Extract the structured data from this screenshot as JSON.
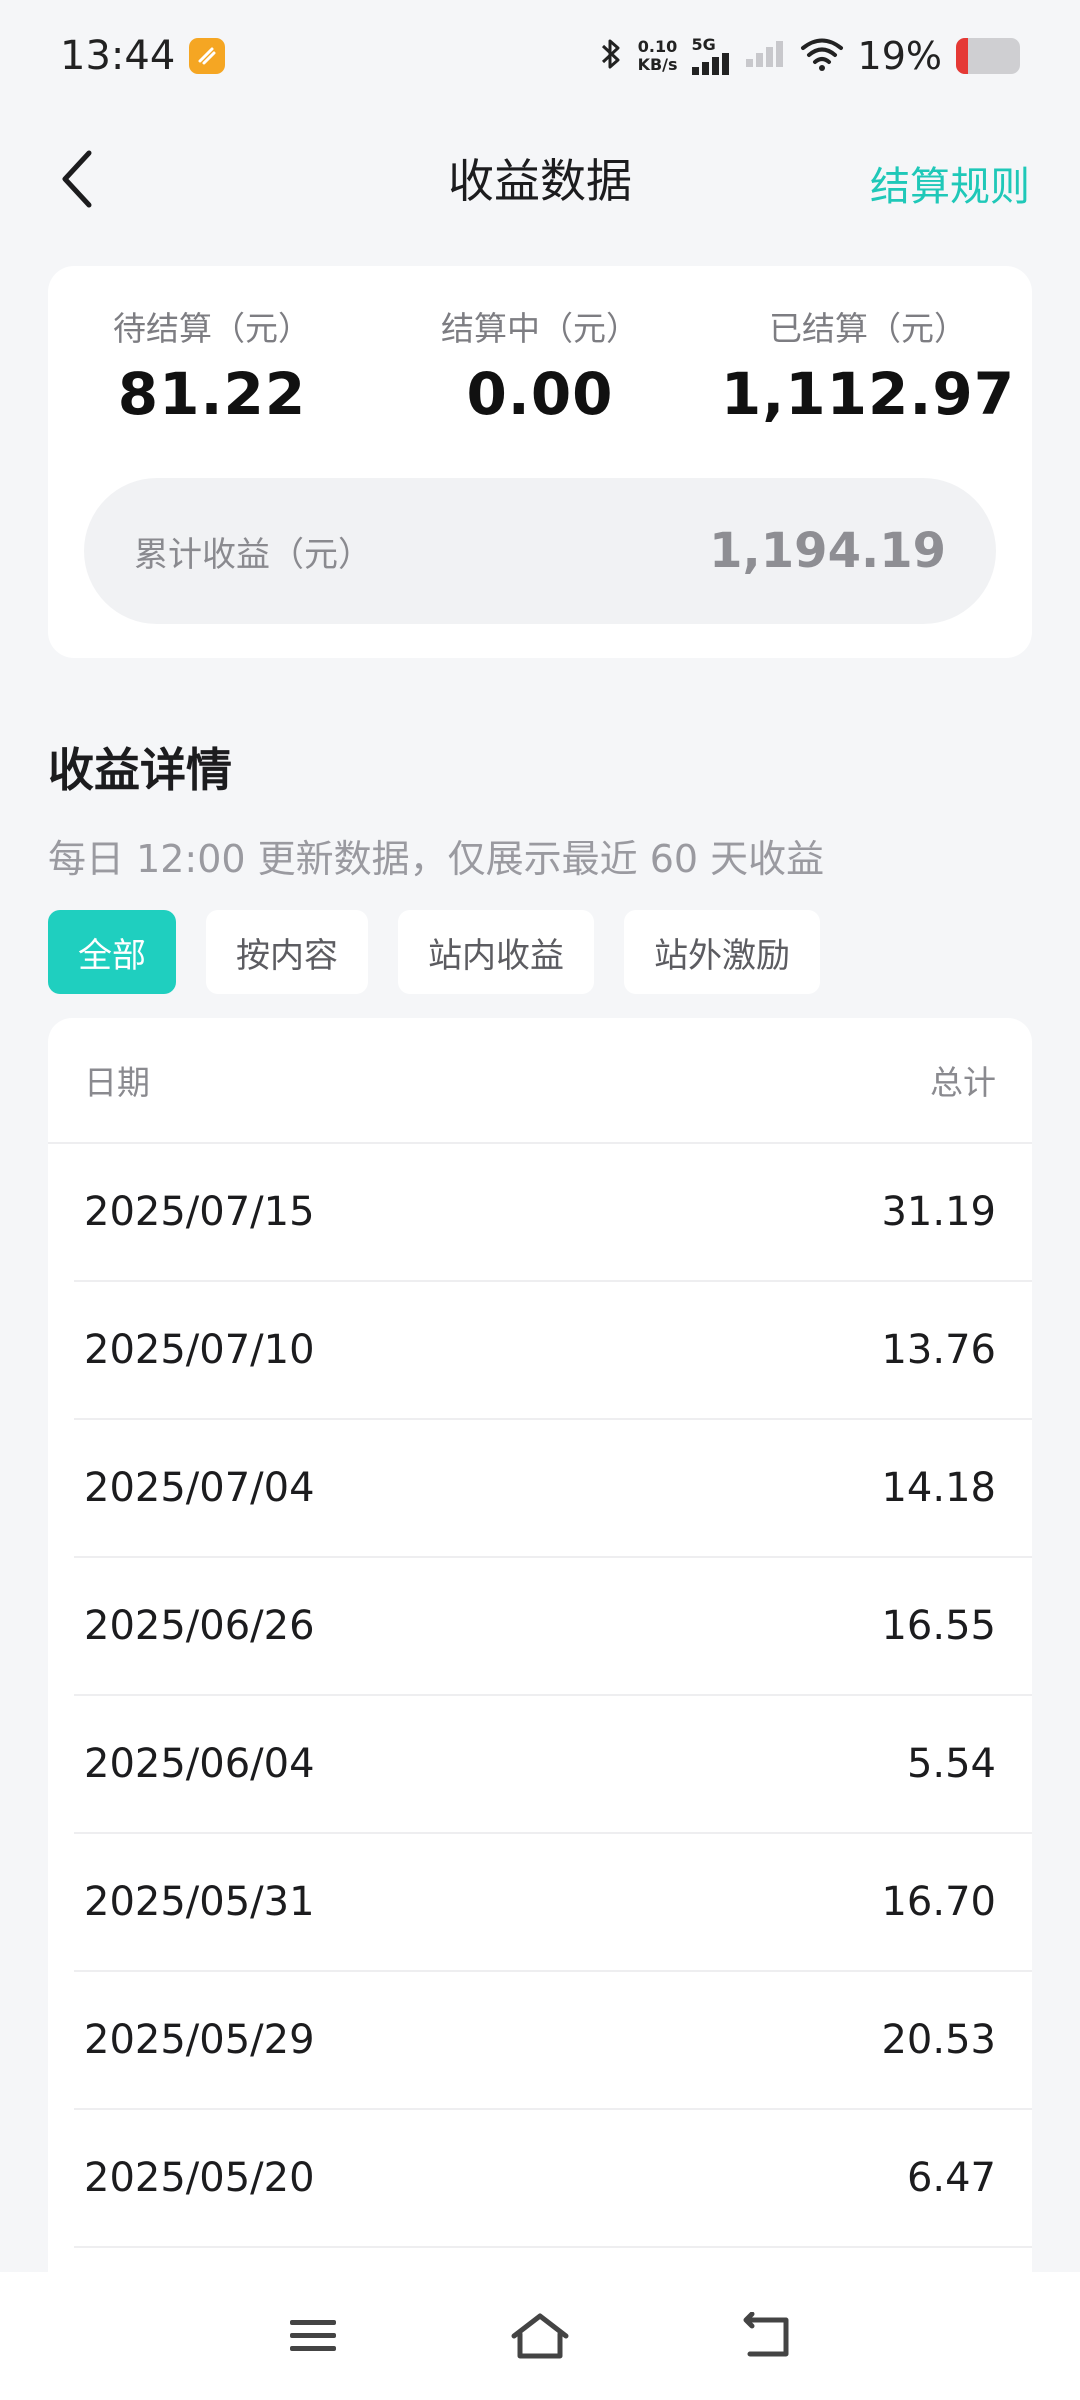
{
  "status_bar": {
    "time": "13:44",
    "net_speed_value": "0.10",
    "net_speed_unit": "KB/s",
    "network_type": "5G",
    "battery_percent": "19%",
    "battery_level": 0.19
  },
  "header": {
    "title": "收益数据",
    "rules_link": "结算规则"
  },
  "summary": {
    "pending_label": "待结算（元）",
    "pending_value": "81.22",
    "settling_label": "结算中（元）",
    "settling_value": "0.00",
    "settled_label": "已结算（元）",
    "settled_value": "1,112.97",
    "cumulative_label": "累计收益（元）",
    "cumulative_value": "1,194.19"
  },
  "details": {
    "title": "收益详情",
    "subtitle": "每日 12:00 更新数据，仅展示最近 60 天收益",
    "filters": [
      "全部",
      "按内容",
      "站内收益",
      "站外激励"
    ]
  },
  "table": {
    "col_date": "日期",
    "col_total": "总计",
    "rows": [
      {
        "date": "2025/07/15",
        "total": "31.19"
      },
      {
        "date": "2025/07/10",
        "total": "13.76"
      },
      {
        "date": "2025/07/04",
        "total": "14.18"
      },
      {
        "date": "2025/06/26",
        "total": "16.55"
      },
      {
        "date": "2025/06/04",
        "total": "5.54"
      },
      {
        "date": "2025/05/31",
        "total": "16.70"
      },
      {
        "date": "2025/05/29",
        "total": "20.53"
      },
      {
        "date": "2025/05/20",
        "total": "6.47"
      }
    ]
  },
  "colors": {
    "accent": "#1fcfbf",
    "battery_low": "#e53935"
  },
  "icons": {
    "back": "chevron-left-icon",
    "menu": "menu-icon",
    "home": "home-icon",
    "back_nav": "back-nav-icon"
  }
}
